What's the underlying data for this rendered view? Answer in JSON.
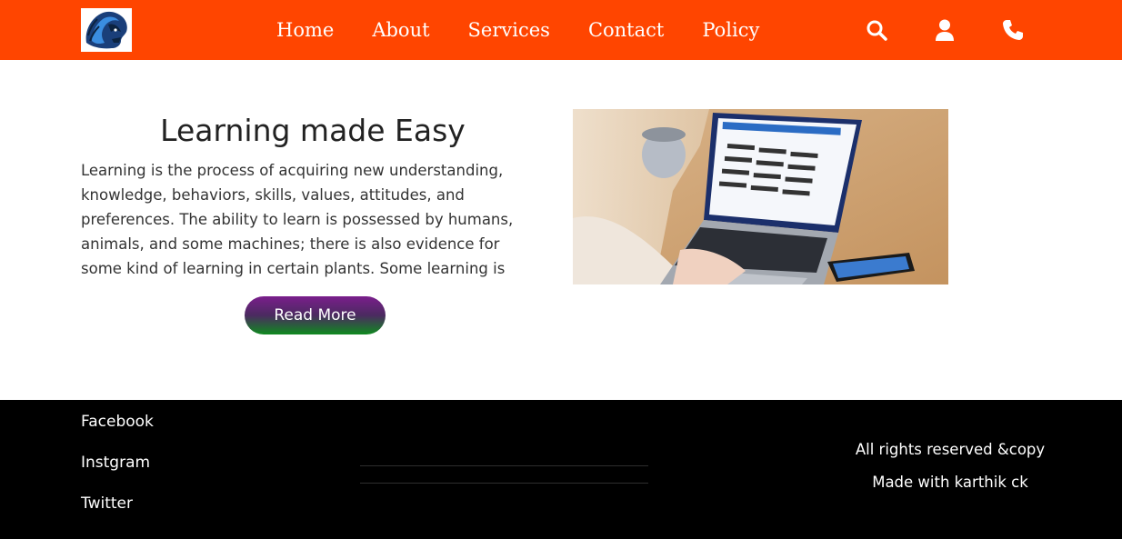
{
  "header": {
    "logo_icon": "lion-head-logo-icon",
    "nav": [
      {
        "label": "Home"
      },
      {
        "label": "About"
      },
      {
        "label": "Services"
      },
      {
        "label": "Contact"
      },
      {
        "label": "Policy"
      }
    ],
    "icons": [
      "search-icon",
      "user-icon",
      "phone-icon"
    ],
    "background_color": "#ff4500"
  },
  "hero": {
    "title": "Learning made Easy",
    "paragraph": "Learning is the process of acquiring new understanding, knowledge, behaviors, skills, values, attitudes, and preferences. The ability to learn is possessed by humans, animals, and some machines; there is also evidence for some kind of learning in certain plants. Some learning is immediate, induced by",
    "button_label": "Read More",
    "image_icon": "laptop-learning-photo"
  },
  "footer": {
    "social": [
      {
        "label": "Facebook"
      },
      {
        "label": "Instgram"
      },
      {
        "label": "Twitter"
      }
    ],
    "rights": "All rights reserved &copy",
    "made_with": "Made with karthik ck",
    "background_color": "#000000"
  }
}
